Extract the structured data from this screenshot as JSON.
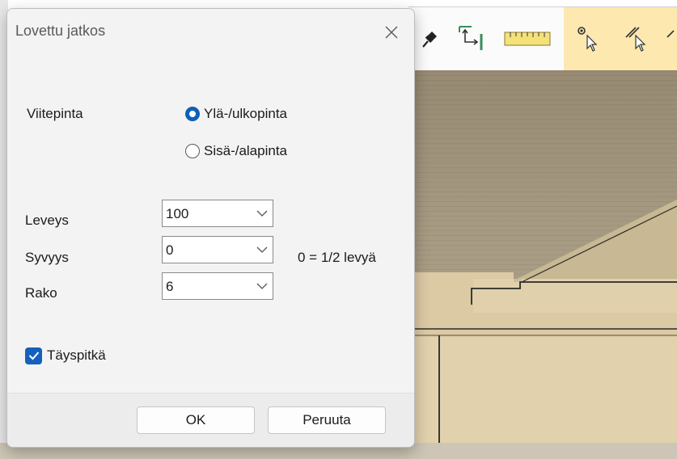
{
  "dialog": {
    "title": "Lovettu jatkos",
    "close_icon": "close-icon",
    "reference": {
      "label": "Viitepinta",
      "options": [
        {
          "label": "Ylä-/ulkopinta",
          "checked": true
        },
        {
          "label": "Sisä-/alapinta",
          "checked": false
        }
      ]
    },
    "fields": {
      "width": {
        "label": "Leveys",
        "value": "100"
      },
      "depth": {
        "label": "Syvyys",
        "value": "0",
        "hint": "0 = 1/2 levyä"
      },
      "gap": {
        "label": "Rako",
        "value": "6"
      }
    },
    "full_length": {
      "label": "Täyspitkä",
      "checked": true
    },
    "buttons": {
      "ok": "OK",
      "cancel": "Peruuta"
    }
  },
  "toolbar": {
    "icons": [
      "pin-icon",
      "corner-connection-icon",
      "measure-ruler-icon",
      "point-select-icon",
      "line-select-icon"
    ],
    "active_color": "#fde8b0"
  },
  "colors": {
    "accent": "#1560bd",
    "wood": "#d9c9a6"
  }
}
